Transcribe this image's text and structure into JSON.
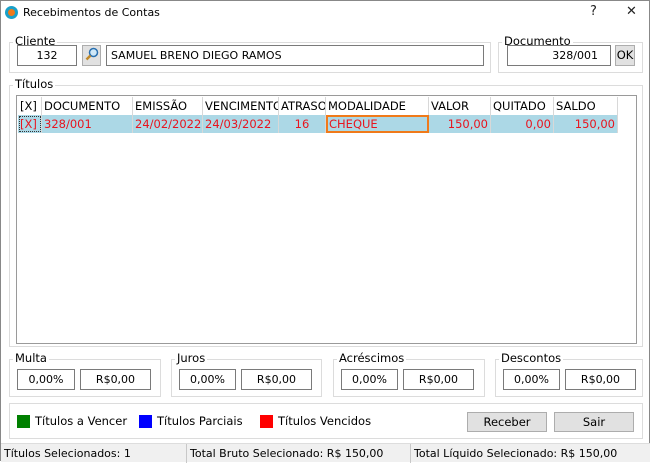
{
  "window": {
    "title": "Recebimentos de Contas",
    "help": "?",
    "close": "✕"
  },
  "cliente": {
    "label": "Cliente",
    "code": "132",
    "name": "SAMUEL BRENO DIEGO RAMOS"
  },
  "documento": {
    "label": "Documento",
    "value": "328/001",
    "ok": "OK"
  },
  "titulos": {
    "label": "Títulos",
    "columns": [
      "[X]",
      "DOCUMENTO",
      "EMISSÃO",
      "VENCIMENTO",
      "ATRASO",
      "MODALIDADE",
      "VALOR",
      "QUITADO",
      "SALDO"
    ],
    "rows": [
      {
        "check": "[X]",
        "documento": "328/001",
        "emissao": "24/02/2022",
        "vencimento": "24/03/2022",
        "atraso": "16",
        "modalidade": "CHEQUE",
        "valor": "150,00",
        "quitado": "0,00",
        "saldo": "150,00"
      }
    ]
  },
  "ajustes": [
    {
      "label": "Multa",
      "pct": "0,00%",
      "valor": "R$0,00"
    },
    {
      "label": "Juros",
      "pct": "0,00%",
      "valor": "R$0,00"
    },
    {
      "label": "Acréscimos",
      "pct": "0,00%",
      "valor": "R$0,00"
    },
    {
      "label": "Descontos",
      "pct": "0,00%",
      "valor": "R$0,00"
    }
  ],
  "legenda": [
    {
      "label": "Títulos a Vencer",
      "color": "#008000"
    },
    {
      "label": "Títulos Parciais",
      "color": "#0000ff"
    },
    {
      "label": "Títulos Vencidos",
      "color": "#ff0000"
    }
  ],
  "buttons": {
    "receber": "Receber",
    "sair": "Sair"
  },
  "status": {
    "selecionados": "Títulos Selecionados: 1",
    "bruto": "Total Bruto Selecionado: R$ 150,00",
    "liquido": "Total Líquido Selecionado: R$ 150,00"
  }
}
